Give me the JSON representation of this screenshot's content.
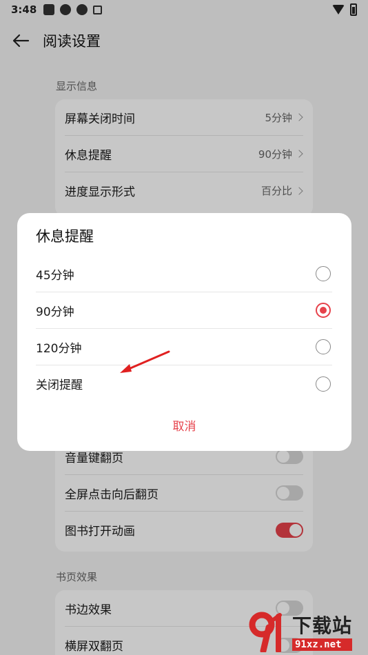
{
  "status_bar": {
    "time": "3:48"
  },
  "header": {
    "title": "阅读设置"
  },
  "sections": {
    "display_info": {
      "label": "显示信息",
      "rows": [
        {
          "label": "屏幕关闭时间",
          "value": "5分钟"
        },
        {
          "label": "休息提醒",
          "value": "90分钟"
        },
        {
          "label": "进度显示形式",
          "value": "百分比"
        }
      ]
    },
    "operation": {
      "rows": [
        {
          "label": "音量键翻页",
          "enabled": false
        },
        {
          "label": "全屏点击向后翻页",
          "enabled": false
        },
        {
          "label": "图书打开动画",
          "enabled": true
        }
      ]
    },
    "page_effect": {
      "label": "书页效果",
      "rows": [
        {
          "label": "书边效果",
          "enabled": false
        },
        {
          "label": "横屏双翻页",
          "enabled": false
        }
      ]
    }
  },
  "dialog": {
    "title": "休息提醒",
    "options": [
      {
        "label": "45分钟",
        "selected": false
      },
      {
        "label": "90分钟",
        "selected": true
      },
      {
        "label": "120分钟",
        "selected": false
      },
      {
        "label": "关闭提醒",
        "selected": false
      }
    ],
    "cancel_label": "取消"
  },
  "watermark": {
    "name": "下载站",
    "url": "91xz.net"
  },
  "colors": {
    "accent": "#e6424b",
    "background": "#f4f4f4"
  }
}
